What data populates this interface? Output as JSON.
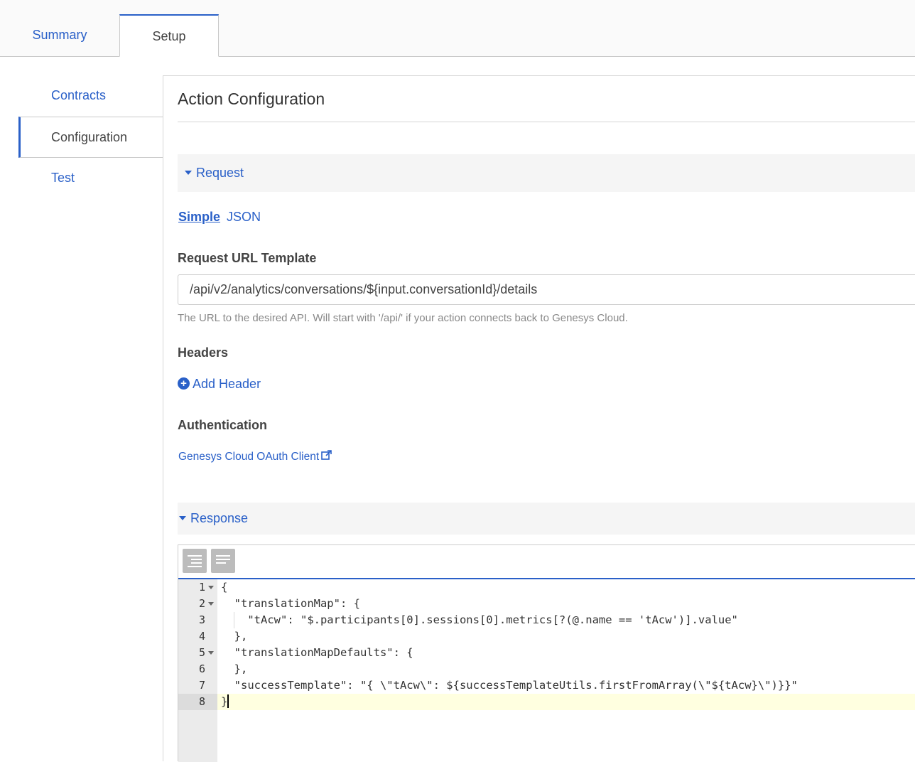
{
  "tabs": {
    "summary": "Summary",
    "setup": "Setup"
  },
  "nav": {
    "contracts": "Contracts",
    "configuration": "Configuration",
    "test": "Test"
  },
  "main": {
    "title": "Action Configuration",
    "request_section": "Request",
    "mode_simple": "Simple",
    "mode_json": "JSON",
    "url_label": "Request URL Template",
    "url_value": "/api/v2/analytics/conversations/${input.conversationId}/details",
    "url_help": "The URL to the desired API. Will start with '/api/' if your action connects back to Genesys Cloud.",
    "headers_label": "Headers",
    "add_header": "Add Header",
    "auth_label": "Authentication",
    "auth_link": "Genesys Cloud OAuth Client",
    "response_section": "Response"
  },
  "editor": {
    "line_numbers": [
      "1",
      "2",
      "3",
      "4",
      "5",
      "6",
      "7",
      "8"
    ],
    "lines": [
      "{",
      "  \"translationMap\": {",
      "    \"tAcw\": \"$.participants[0].sessions[0].metrics[?(@.name == 'tAcw')].value\"",
      "  },",
      "  \"translationMapDefaults\": {",
      "  },",
      "  \"successTemplate\": \"{ \\\"tAcw\\\": ${successTemplateUtils.firstFromArray(\\\"${tAcw}\\\")}}\"",
      "}"
    ]
  }
}
